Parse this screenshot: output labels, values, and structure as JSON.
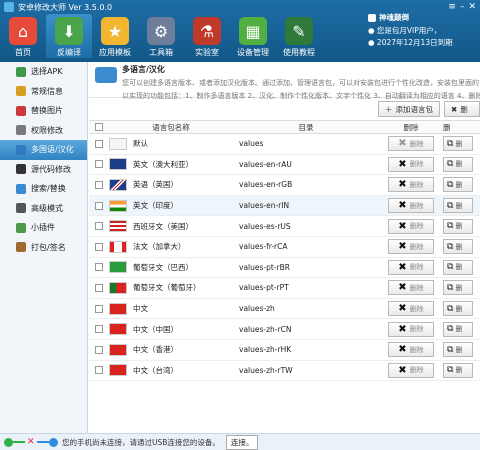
{
  "app": {
    "title": "安卓修改大师 Ver 3.5.0.0"
  },
  "toolbar": {
    "items": [
      {
        "label": "首页",
        "color": "#e84a3a",
        "glyph": "⌂"
      },
      {
        "label": "反编译",
        "color": "#4aa54a",
        "glyph": "⬇"
      },
      {
        "label": "应用模板",
        "color": "#f2b630",
        "glyph": "★"
      },
      {
        "label": "工具箱",
        "color": "#6e7e9a",
        "glyph": "⚙"
      },
      {
        "label": "实验室",
        "color": "#c0392b",
        "glyph": "⚗"
      },
      {
        "label": "设备管理",
        "color": "#52b043",
        "glyph": "▦"
      },
      {
        "label": "使用教程",
        "color": "#2f7a3a",
        "glyph": "✎"
      }
    ]
  },
  "news": {
    "title": "神魂颠倒",
    "lines": [
      "● 您是包月VIP用户，",
      "● 2027年12月13日到期"
    ]
  },
  "sidebar": {
    "items": [
      {
        "label": "选择APK",
        "color": "#3a9a4a"
      },
      {
        "label": "常规信息",
        "color": "#d8a020"
      },
      {
        "label": "替换图片",
        "color": "#cc3a3a"
      },
      {
        "label": "权限修改",
        "color": "#7a7a7a"
      },
      {
        "label": "多国语/汉化",
        "color": "#2f7ac0"
      },
      {
        "label": "源代码修改",
        "color": "#333333"
      },
      {
        "label": "搜索/替换",
        "color": "#3a8ad0"
      },
      {
        "label": "高级模式",
        "color": "#555555"
      },
      {
        "label": "小插件",
        "color": "#4a9a4a"
      },
      {
        "label": "打包/签名",
        "color": "#a06a30"
      }
    ]
  },
  "main": {
    "title": "多语言/汉化",
    "desc1": "您可以创建多语言版本、或者添加汉化版本。通过添加、管理语言包，可以对安装包进行个性化改造，安装包里面的",
    "desc2": "以实现的功能包括：1、制作多语言版本 2、汉化、制作个性化版本、文字个性化 3、自动翻译为相应的语言 4、删除",
    "add_button": "添加语言包",
    "delete_button": "删"
  },
  "table": {
    "headers": {
      "name": "语言包名称",
      "dir": "目录",
      "del": "删除",
      "del2": "删"
    },
    "row_delete": "删除",
    "row_extra": "删",
    "rows": [
      {
        "name": "默认",
        "dir": "values",
        "flag": "default",
        "disabled": true
      },
      {
        "name": "英文（澳大利亚）",
        "dir": "values-en-rAU",
        "flag": "au"
      },
      {
        "name": "英语（英国）",
        "dir": "values-en-rGB",
        "flag": "gb"
      },
      {
        "name": "英文（印度）",
        "dir": "values-en-rIN",
        "flag": "in",
        "selected": true
      },
      {
        "name": "西班牙文（美国）",
        "dir": "values-es-rUS",
        "flag": "us"
      },
      {
        "name": "法文（加拿大）",
        "dir": "values-fr-rCA",
        "flag": "ca"
      },
      {
        "name": "葡萄牙文（巴西）",
        "dir": "values-pt-rBR",
        "flag": "br"
      },
      {
        "name": "葡萄牙文（葡萄牙）",
        "dir": "values-pt-rPT",
        "flag": "pt"
      },
      {
        "name": "中文",
        "dir": "values-zh",
        "flag": "cn"
      },
      {
        "name": "中文（中国）",
        "dir": "values-zh-rCN",
        "flag": "cn"
      },
      {
        "name": "中文（香港）",
        "dir": "values-zh-rHK",
        "flag": "hk"
      },
      {
        "name": "中文（台湾）",
        "dir": "values-zh-rTW",
        "flag": "tw"
      }
    ]
  },
  "status": {
    "message": "您的手机尚未连接，请通过USB连接您的设备。",
    "connect_button": "连接。"
  }
}
